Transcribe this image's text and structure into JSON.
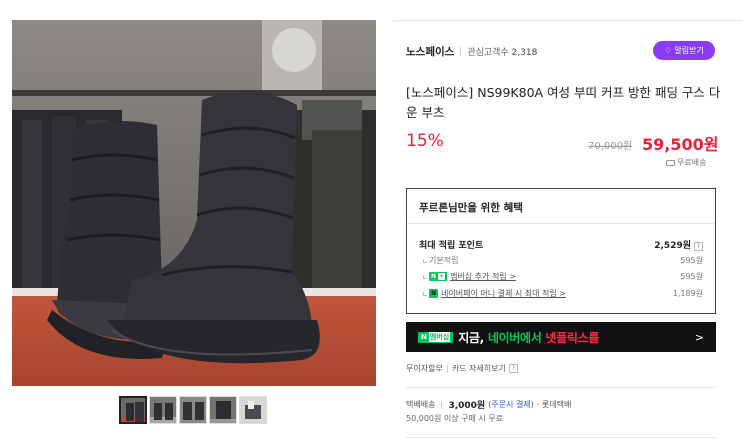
{
  "store": {
    "name": "노스페이스",
    "fans_label": "관심고객수",
    "fans_count": "2,318",
    "talk_button": "알림받기"
  },
  "product": {
    "title": "[노스페이스] NS99K80A 여성 부띠 커프 방한 패딩 구스 다운 부츠",
    "discount": "15%",
    "original_price": "70,000원",
    "sale_price": "59,500원",
    "shipping_badge": "무료배송"
  },
  "benefit": {
    "heading": "푸르른님만을 위한 혜택",
    "max_points_label": "최대 적립 포인트",
    "max_points_value": "2,529원",
    "help_glyph": "?",
    "rows": [
      {
        "label": "기본적립",
        "value": "595원"
      },
      {
        "label": "멤버십 추가 적립 >",
        "value": "595원"
      },
      {
        "label": "네이버페이 머니 결제 시 최대 적립 >",
        "value": "1,189원"
      }
    ],
    "np_tag": "N",
    "np_plus": "+"
  },
  "banner": {
    "tag": "N",
    "tag_plus": "멤버십",
    "text_white": "지금, ",
    "text_green": "네이버에서 ",
    "text_red": "넷플릭스를",
    "arrow": ">"
  },
  "card": {
    "installment": "무이자할부",
    "card_detail": "카드 자세히보기",
    "help_glyph": "?"
  },
  "shipping": {
    "label": "택배배송",
    "fee": "3,000원",
    "note_blue": "(주문시 결제)",
    "carrier": "· 롯데택배",
    "threshold": "50,000원 이상 구매 시 무료"
  },
  "colors": {
    "accent_red": "#e8223a",
    "talk_purple": "#8a3cf0",
    "naver_green": "#03c75a"
  },
  "icons": [
    "bell-icon",
    "truck-icon",
    "chevron-right-icon"
  ]
}
